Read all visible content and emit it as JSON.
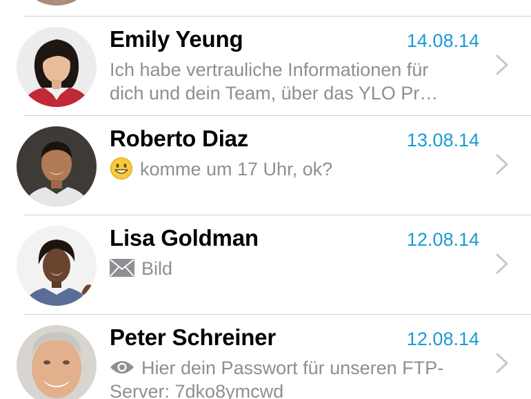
{
  "chats": [
    {
      "name": "Emily Yeung",
      "date": "14.08.14",
      "message_lines": [
        "Ich habe vertrauliche Informationen für",
        "dich und dein Team, über das YLO Pr…"
      ],
      "icon": "none"
    },
    {
      "name": "Roberto Diaz",
      "date": "13.08.14",
      "message_lines": [
        "komme um 17 Uhr, ok?"
      ],
      "icon": "smiley-emoji-icon"
    },
    {
      "name": "Lisa Goldman",
      "date": "12.08.14",
      "message_lines": [
        "Bild"
      ],
      "icon": "envelope-icon"
    },
    {
      "name": "Peter Schreiner",
      "date": "12.08.14",
      "message_lines": [
        "Hier dein Passwort für unseren FTP-",
        "Server: 7dko8ymcwd"
      ],
      "icon": "eye-icon"
    }
  ],
  "colors": {
    "date": "#1a9ad6",
    "preview_text": "#8e8e93",
    "separator": "#cfcfd4",
    "chevron": "#c7c7cc"
  }
}
